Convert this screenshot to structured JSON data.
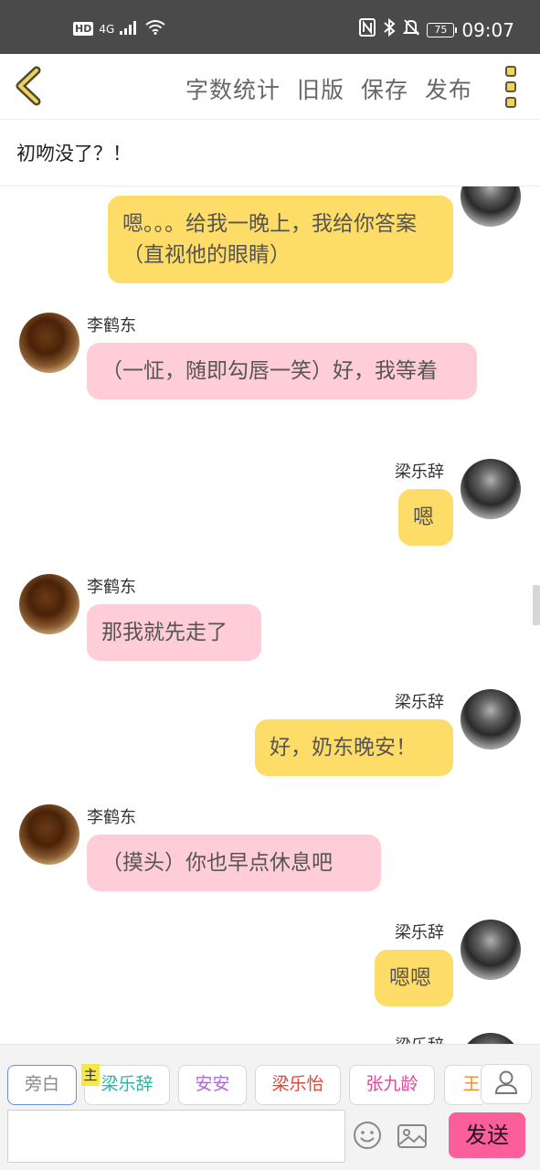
{
  "status_bar": {
    "hd": "HD",
    "network": "4G",
    "battery": "75",
    "time": "09:07"
  },
  "toolbar": {
    "actions": [
      "字数统计",
      "旧版",
      "保存",
      "发布"
    ]
  },
  "story": {
    "title": "初吻没了？！"
  },
  "characters": {
    "a_name": "李鹤东",
    "b_name": "梁乐辞"
  },
  "messages": [
    {
      "speaker": "梁乐辞",
      "text": "嗯。。。给我一晚上，我给你答案（直视他的眼睛）"
    },
    {
      "speaker": "李鹤东",
      "text": "（一怔，随即勾唇一笑）好，我等着"
    },
    {
      "speaker": "梁乐辞",
      "text": "嗯"
    },
    {
      "speaker": "李鹤东",
      "text": "那我就先走了"
    },
    {
      "speaker": "梁乐辞",
      "text": "好，奶东晚安！"
    },
    {
      "speaker": "李鹤东",
      "text": "（摸头）你也早点休息吧"
    },
    {
      "speaker": "梁乐辞",
      "text": "嗯嗯"
    }
  ],
  "role_selector": {
    "host_badge": "主",
    "roles": [
      {
        "label": "旁白",
        "color": "#888888"
      },
      {
        "label": "梁乐辞",
        "color": "#2bb5a6"
      },
      {
        "label": "安安",
        "color": "#b06ad0"
      },
      {
        "label": "梁乐怡",
        "color": "#e0473a"
      },
      {
        "label": "张九龄",
        "color": "#d84a9a"
      },
      {
        "label": "王",
        "color": "#f08a24"
      }
    ]
  },
  "composer": {
    "placeholder": "",
    "send_label": "发送"
  },
  "colors": {
    "self_bubble": "#fedc68",
    "other_bubble": "#fecdd8",
    "send_button": "#fb5f9a",
    "status_bar": "#4a4a4a"
  }
}
